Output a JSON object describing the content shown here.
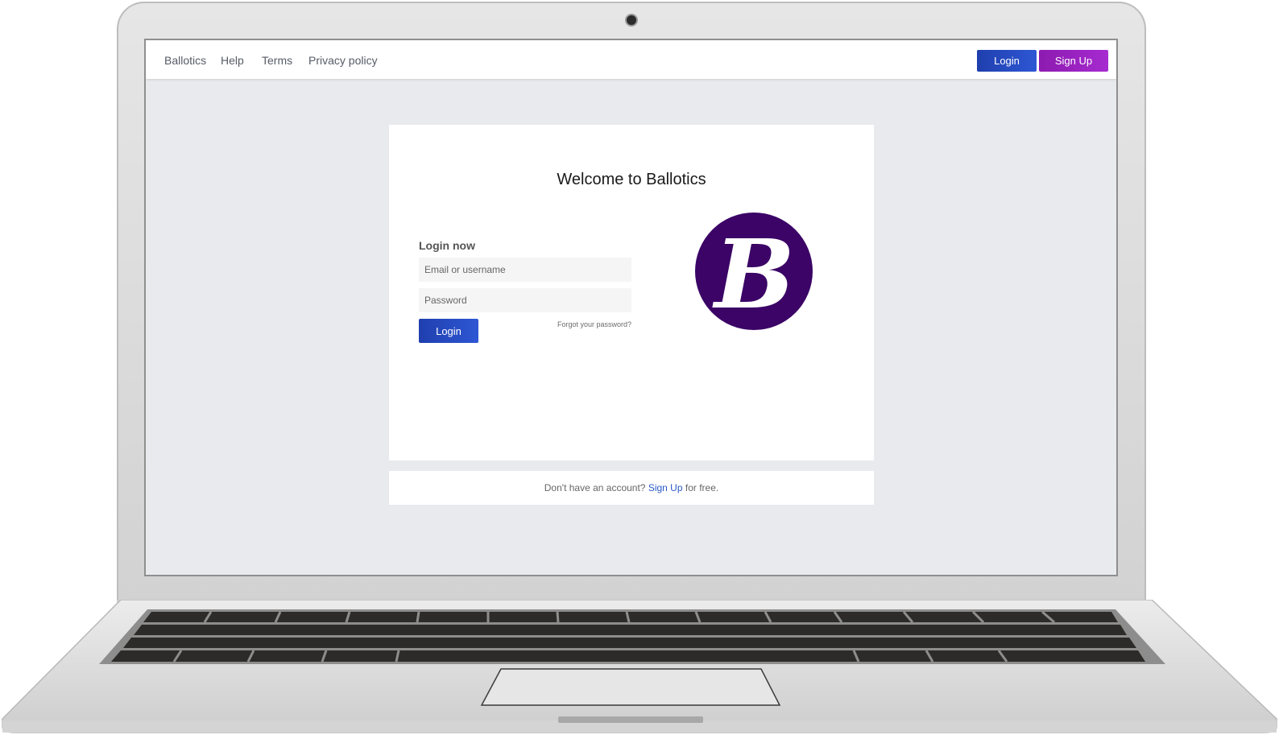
{
  "nav": {
    "links": [
      "Ballotics",
      "Help",
      "Terms",
      "Privacy policy"
    ],
    "login_label": "Login",
    "signup_label": "Sign Up"
  },
  "card": {
    "title": "Welcome to Ballotics",
    "section_heading": "Login now",
    "email_placeholder": "Email or username",
    "password_placeholder": "Password",
    "forgot_label": "Forgot your password?",
    "login_label": "Login",
    "logo_letter": "B"
  },
  "footer": {
    "prefix": "Don't have an account?",
    "link": "Sign Up",
    "suffix": "for free."
  },
  "colors": {
    "accent_blue": "#2a4fc8",
    "accent_purple": "#9b22c4",
    "logo_purple": "#3b0466",
    "page_bg": "#e9eaee"
  },
  "icons": [
    "webcam-icon",
    "ballotics-logo-icon"
  ]
}
